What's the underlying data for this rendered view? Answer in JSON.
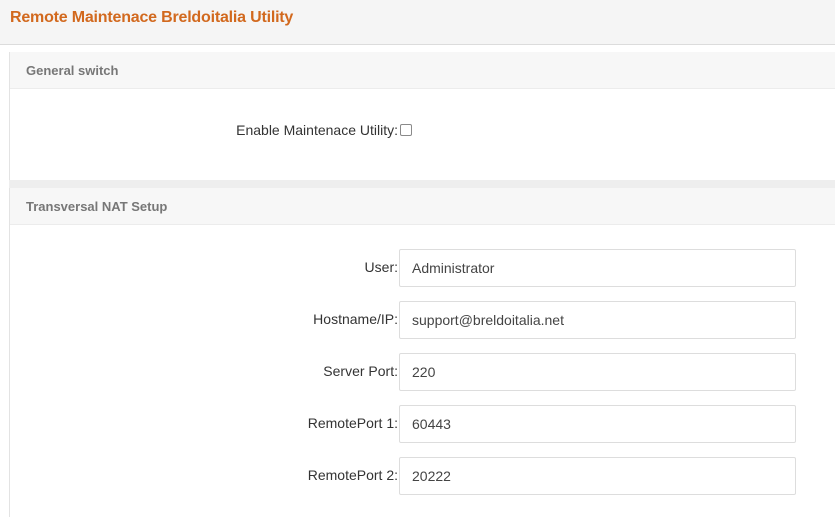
{
  "header": {
    "title": "Remote Maintenace Breldoitalia Utility"
  },
  "general_switch": {
    "title": "General switch",
    "enable_label": "Enable Maintenace Utility:",
    "enabled": false
  },
  "nat_setup": {
    "title": "Transversal NAT Setup",
    "fields": [
      {
        "label": "User:",
        "value": "Administrator"
      },
      {
        "label": "Hostname/IP:",
        "value": "support@breldoitalia.net"
      },
      {
        "label": "Server Port:",
        "value": "220"
      },
      {
        "label": "RemotePort 1:",
        "value": "60443"
      },
      {
        "label": "RemotePort 2:",
        "value": "20222"
      }
    ]
  },
  "colors": {
    "title_accent": "#d2691e",
    "section_title": "#777777"
  }
}
